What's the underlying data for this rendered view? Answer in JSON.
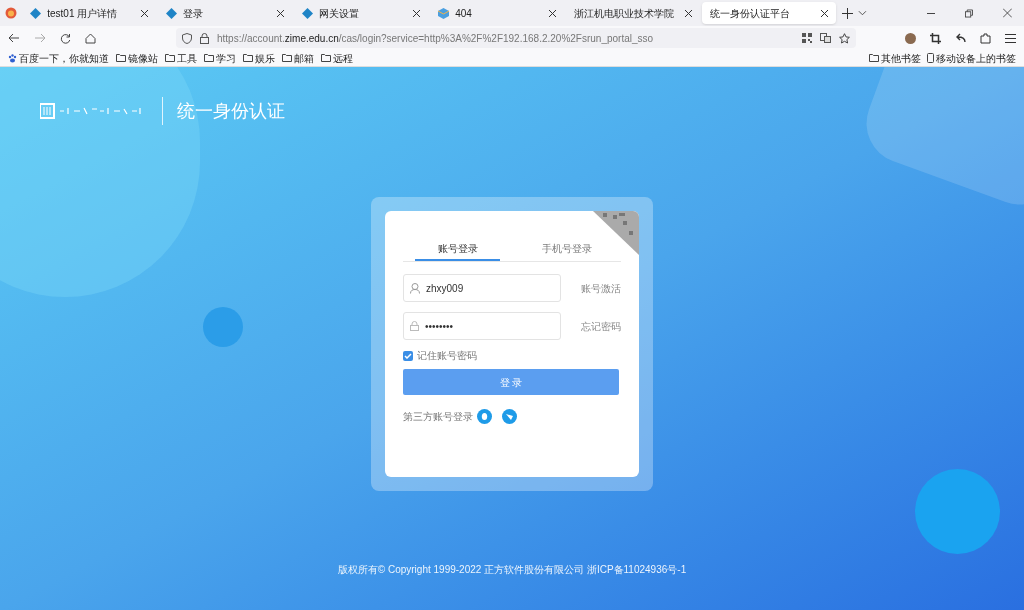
{
  "browser": {
    "tabs": [
      {
        "title": "test01 用户详情",
        "selected": false,
        "kind": "diamond"
      },
      {
        "title": "登录",
        "selected": false,
        "kind": "diamond"
      },
      {
        "title": "网关设置",
        "selected": false,
        "kind": "diamond"
      },
      {
        "title": "404",
        "selected": false,
        "kind": "cube"
      },
      {
        "title": "浙江机电职业技术学院",
        "selected": false,
        "kind": "none"
      },
      {
        "title": "统一身份认证平台",
        "selected": true,
        "kind": "none"
      }
    ],
    "address": {
      "prefix": "https://account.",
      "domain": "zime.edu.cn",
      "path": "/cas/login?service=http%3A%2F%2F192.168.2.20%2Fsrun_portal_sso"
    },
    "bookmarks": [
      {
        "label": "百度一下，你就知道",
        "kind": "paw"
      },
      {
        "label": "镜像站",
        "kind": "folder"
      },
      {
        "label": "工具",
        "kind": "folder"
      },
      {
        "label": "学习",
        "kind": "folder"
      },
      {
        "label": "娱乐",
        "kind": "folder"
      },
      {
        "label": "邮箱",
        "kind": "folder"
      },
      {
        "label": "远程",
        "kind": "folder"
      }
    ],
    "bookmarks_right": [
      {
        "label": "其他书签",
        "kind": "folder"
      },
      {
        "label": "移动设备上的书签",
        "kind": "mobile"
      }
    ]
  },
  "page": {
    "title": "统一身份认证",
    "login": {
      "tabs": [
        {
          "label": "账号登录",
          "selected": true
        },
        {
          "label": "手机号登录",
          "selected": false
        }
      ],
      "username": {
        "value": "zhxy009",
        "link": "账号激活"
      },
      "password": {
        "value": "••••••••",
        "link": "忘记密码"
      },
      "remember": {
        "label": "记住账号密码",
        "checked": true
      },
      "submit": "登 录",
      "third_party": "第三方账号登录"
    },
    "footer": "版权所有© Copyright 1999-2022 正方软件股份有限公司 浙ICP备11024936号-1"
  }
}
